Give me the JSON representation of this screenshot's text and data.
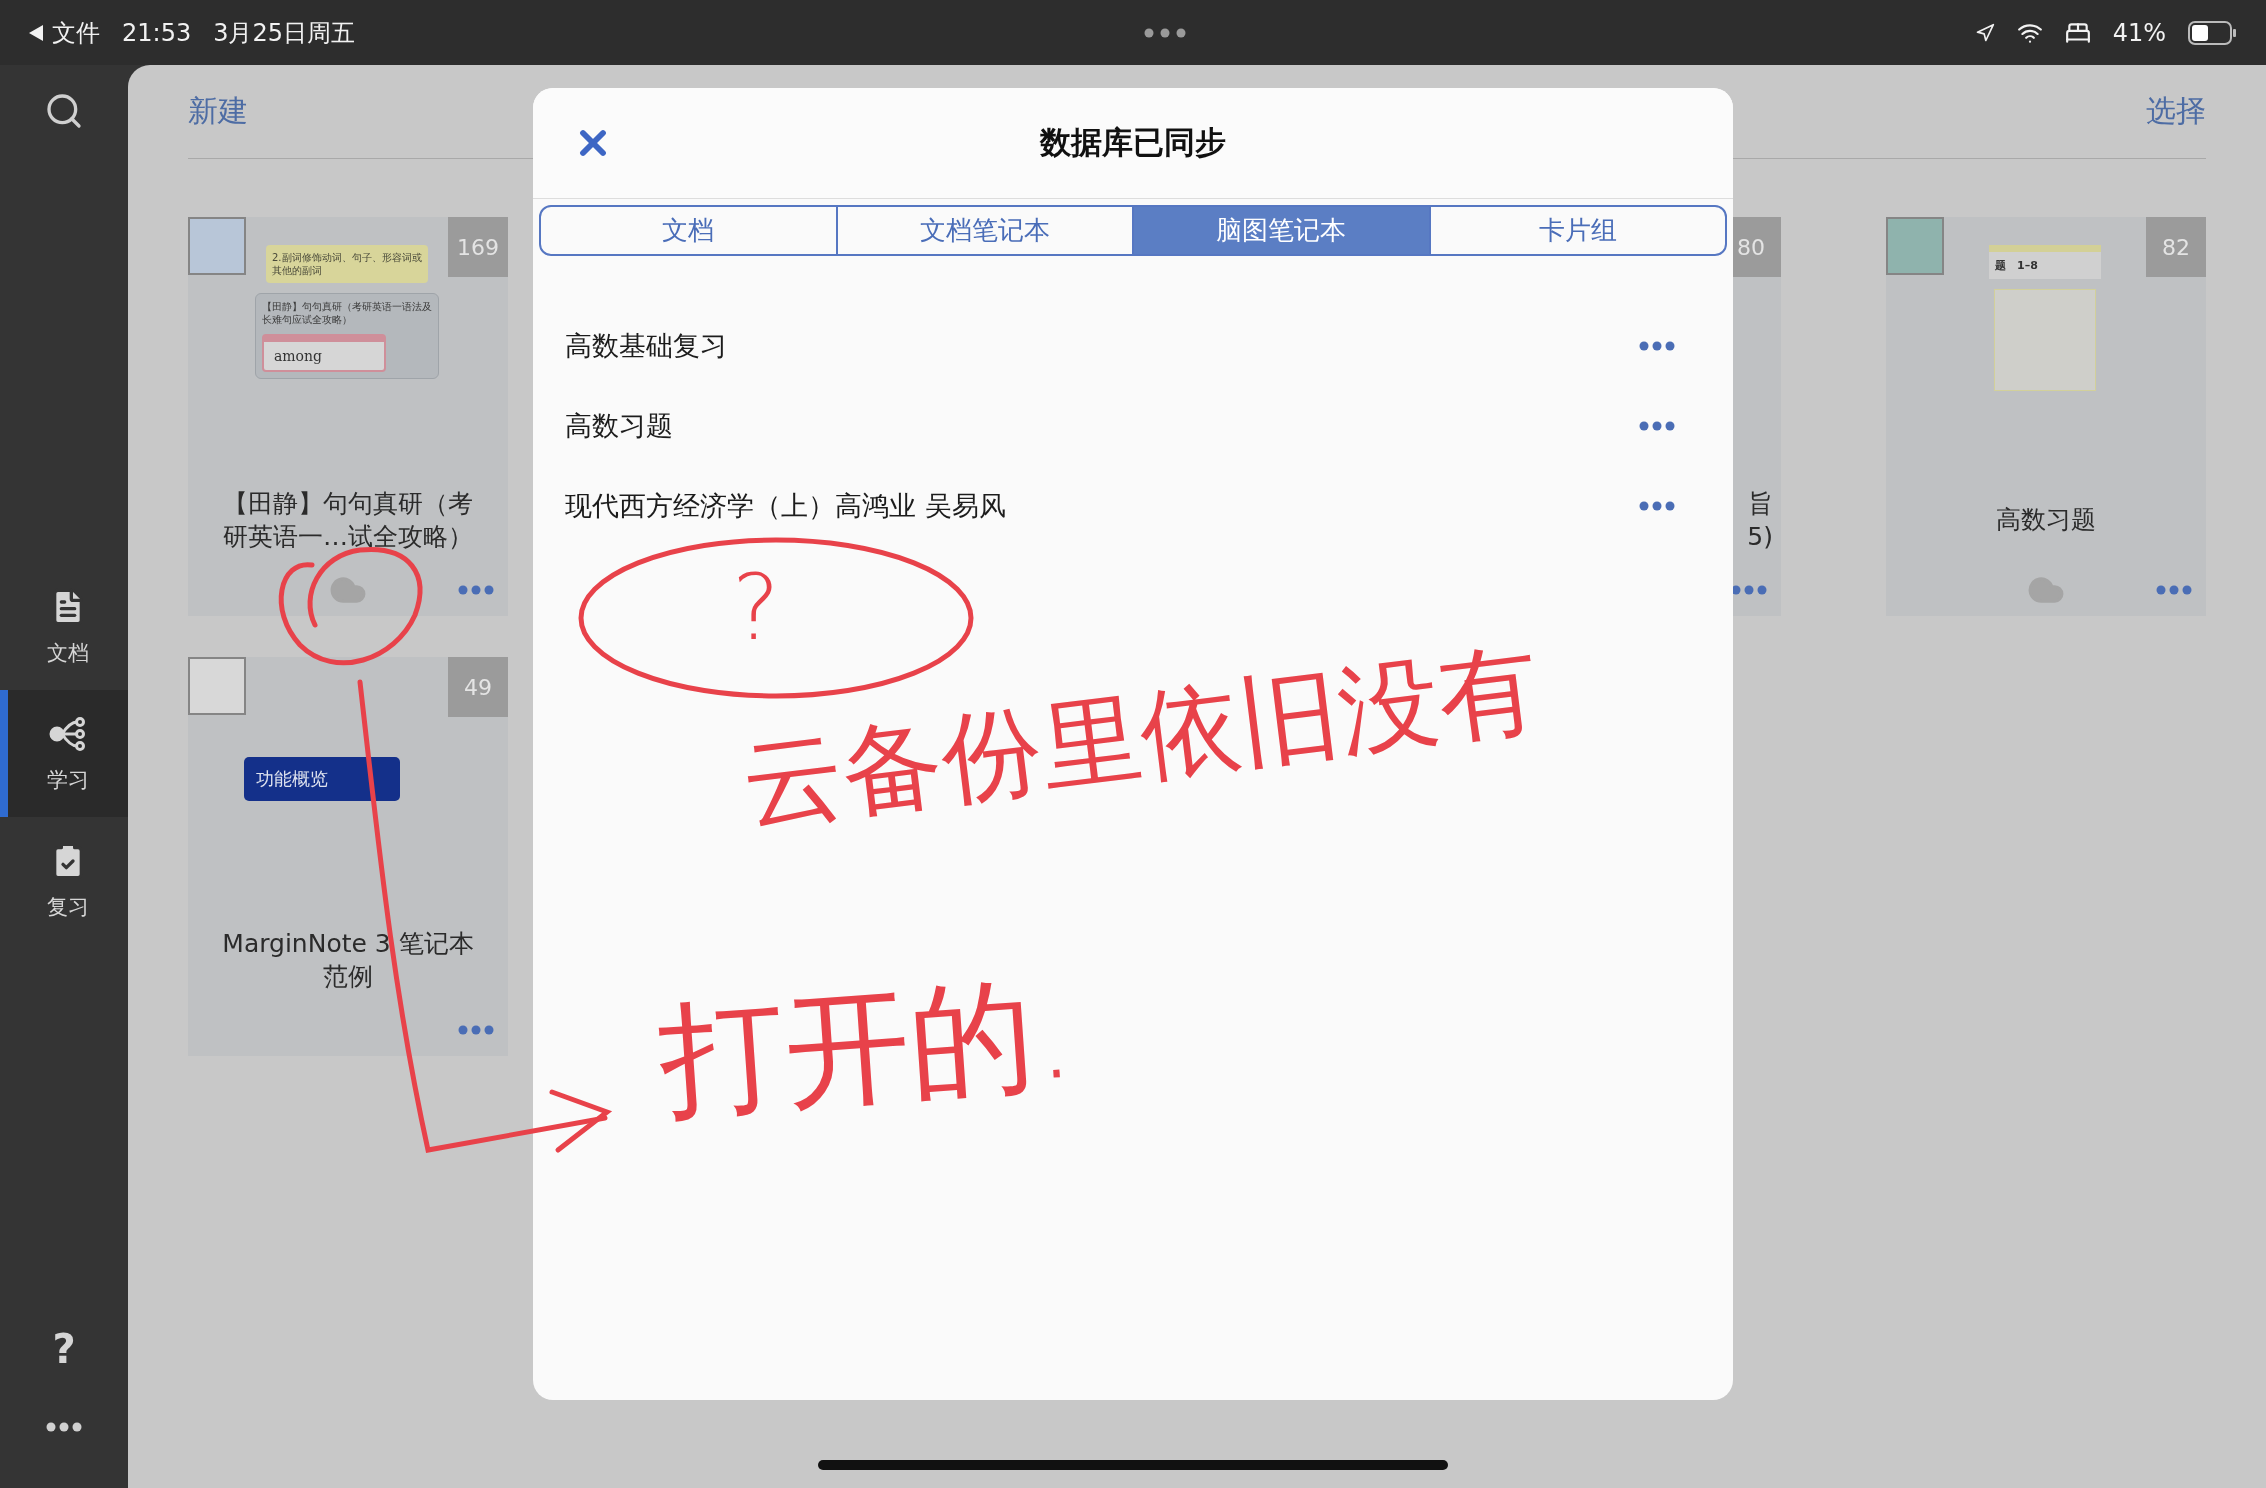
{
  "status_bar": {
    "back_label": "文件",
    "time": "21:53",
    "date": "3月25日周五",
    "battery": "41%"
  },
  "sidebar": {
    "items": [
      {
        "label": "文档",
        "kind": "document",
        "selected": false
      },
      {
        "label": "学习",
        "kind": "mindmap",
        "selected": true
      },
      {
        "label": "复习",
        "kind": "review",
        "selected": false
      }
    ],
    "help": "?"
  },
  "header": {
    "new": "新建",
    "select": "选择"
  },
  "cards": [
    {
      "kind": "full",
      "count": "169",
      "title": "【田静】句句真研（考研英语一…试全攻略）",
      "cloud": true,
      "preview": {
        "kind": "cards",
        "texts": [
          "2.副词修饰动词、句子、形容词或其他的副词",
          "【田静】句句真研（考研英语一语法及长难句应试全攻略）",
          "among"
        ]
      }
    },
    {
      "kind": "spacer"
    },
    {
      "kind": "partial",
      "count": "80",
      "title_lines": [
        "旨",
        "5)"
      ],
      "cloud": false
    },
    {
      "kind": "full",
      "count": "82",
      "title": "高数习题",
      "cloud": true,
      "preview": {
        "kind": "pages",
        "texts": [
          "题　1–8"
        ]
      }
    },
    {
      "kind": "full",
      "count": "49",
      "title": "MarginNote 3 笔记本范例",
      "cloud": false,
      "preview": {
        "kind": "mindmap",
        "texts": [
          "功能概览"
        ]
      }
    }
  ],
  "modal": {
    "title": "数据库已同步",
    "tabs": [
      {
        "label": "文档",
        "selected": false
      },
      {
        "label": "文档笔记本",
        "selected": false
      },
      {
        "label": "脑图笔记本",
        "selected": true
      },
      {
        "label": "卡片组",
        "selected": false
      }
    ],
    "items": [
      {
        "title": "高数基础复习"
      },
      {
        "title": "高数习题"
      },
      {
        "title": "现代西方经济学（上）高鸿业 吴易风"
      }
    ]
  },
  "annotations": {
    "question": "?",
    "note": "云备份里依旧没有",
    "note_2": "打开的."
  }
}
